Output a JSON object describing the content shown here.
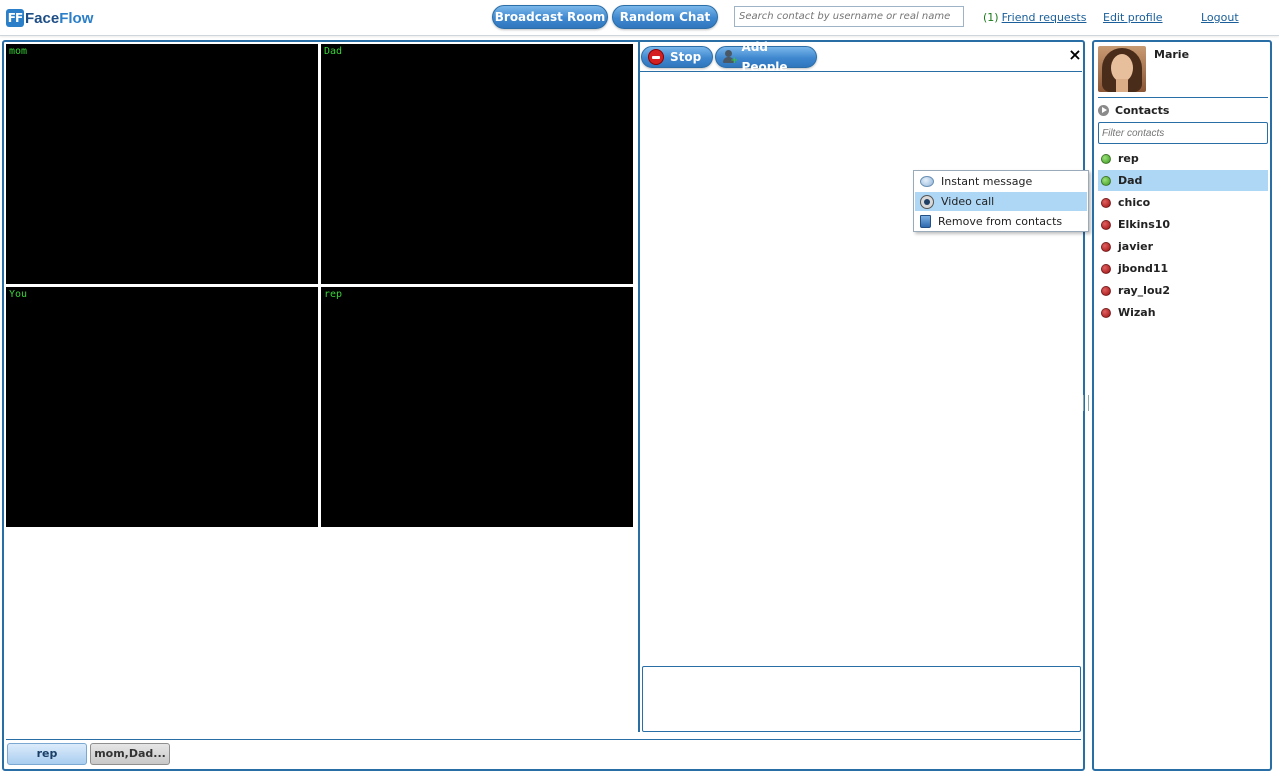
{
  "app": {
    "logo_mark": "FF",
    "logo_face": "Face",
    "logo_flow": "Flow"
  },
  "header": {
    "broadcast_label": "Broadcast Room",
    "random_label": "Random Chat",
    "search_placeholder": "Search contact by username or real name",
    "friend_requests_count": "(1)",
    "friend_requests_label": "Friend requests",
    "edit_profile_label": "Edit profile",
    "logout_label": "Logout"
  },
  "videos": [
    {
      "label": "mom"
    },
    {
      "label": "Dad"
    },
    {
      "label": "You"
    },
    {
      "label": "rep"
    }
  ],
  "call_toolbar": {
    "stop_label": "Stop",
    "add_people_label": "Add People",
    "close_glyph": "×"
  },
  "context_menu": {
    "items": [
      {
        "label": "Instant message",
        "icon": "chat-bubble-icon",
        "selected": false
      },
      {
        "label": "Video call",
        "icon": "webcam-icon",
        "selected": true
      },
      {
        "label": "Remove from contacts",
        "icon": "trash-icon",
        "selected": false
      }
    ]
  },
  "tabs": [
    {
      "label": "rep",
      "active": true
    },
    {
      "label": "mom,Dad...",
      "active": false
    }
  ],
  "sidebar": {
    "user_name": "Marie",
    "contacts_heading": "Contacts",
    "filter_placeholder": "Filter contacts",
    "contacts": [
      {
        "name": "rep",
        "status": "online",
        "selected": false
      },
      {
        "name": "Dad",
        "status": "online",
        "selected": true
      },
      {
        "name": "chico",
        "status": "offline",
        "selected": false
      },
      {
        "name": "Elkins10",
        "status": "offline",
        "selected": false
      },
      {
        "name": "javier",
        "status": "offline",
        "selected": false
      },
      {
        "name": "jbond11",
        "status": "offline",
        "selected": false
      },
      {
        "name": "ray_lou2",
        "status": "offline",
        "selected": false
      },
      {
        "name": "Wizah",
        "status": "offline",
        "selected": false
      }
    ]
  },
  "colors": {
    "accent": "#2a6ea6",
    "selection": "#aed6f5",
    "online": "#3d9a1e",
    "offline": "#a01010",
    "video_label": "#35d435"
  }
}
